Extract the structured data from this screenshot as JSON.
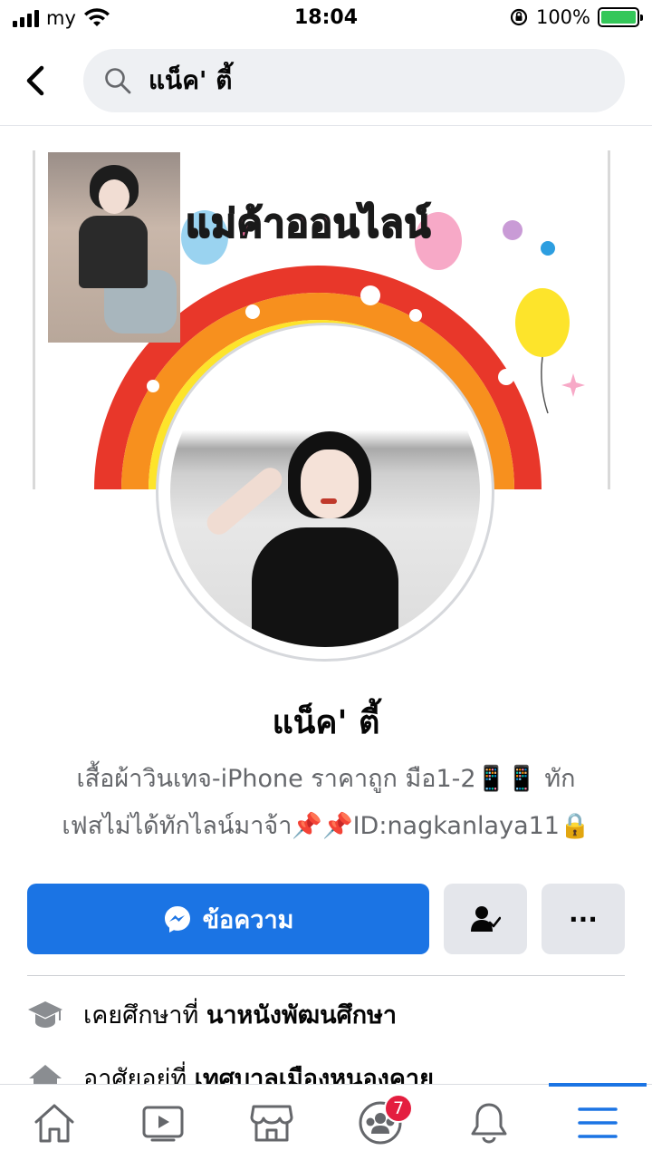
{
  "status_bar": {
    "carrier": "my",
    "time": "18:04",
    "battery": "100%",
    "battery_level": 1.0
  },
  "search": {
    "query": "แน็ค' ตี้"
  },
  "cover": {
    "banner_text": "แม่ค้าออนไลน์"
  },
  "profile": {
    "name": "แน็ค' ตี้",
    "bio_line1": "เสื้อผ้าวินเทจ-iPhone ราคาถูก มือ1-2📱📱 ทัก",
    "bio_line2": "เฟสไม่ได้ทักไลน์มาจ้า📌📌ID:nagkanlaya11🔒"
  },
  "actions": {
    "message_label": "ข้อความ",
    "more_label": "···"
  },
  "details": [
    {
      "prefix": "เคยศึกษาที่ ",
      "value": "นาหนังพัฒนศึกษา",
      "icon": "graduation-cap-icon"
    },
    {
      "prefix": "อาศัยอยู่ที่ ",
      "value": "เทศบาลเมืองหนองคาย",
      "icon": "home-icon"
    }
  ],
  "bottom_nav": {
    "groups_badge": "7",
    "active": "menu"
  },
  "colors": {
    "accent": "#1b74e4",
    "badge": "#e41e3f",
    "battery": "#34c759"
  }
}
